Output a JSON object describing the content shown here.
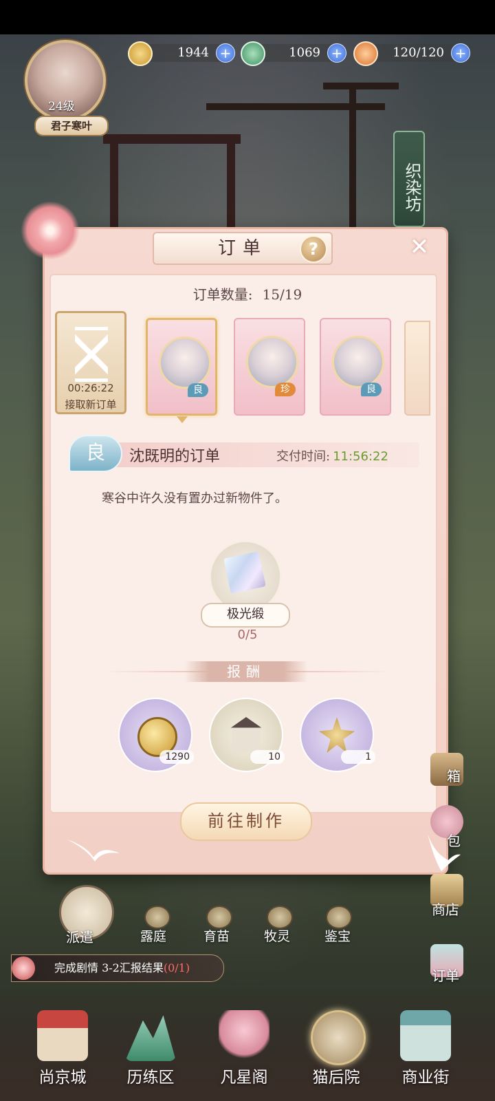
{
  "player": {
    "level": "24级",
    "name": "君子寒叶"
  },
  "resources": [
    {
      "icon": "paw-coin-icon",
      "value": "1944"
    },
    {
      "icon": "jade-icon",
      "value": "1069"
    },
    {
      "icon": "stamina-food-icon",
      "value": "120/120"
    }
  ],
  "side_tab": "织染坊",
  "dialog": {
    "title": "订单",
    "help": "?",
    "close": "✕",
    "count_label": "订单数量:",
    "count_value": "15/19",
    "new_order": {
      "timer": "00:26:22",
      "label": "接取新订单"
    },
    "cards": [
      {
        "grade": "良",
        "color": "#5b9bb7"
      },
      {
        "grade": "珍",
        "color": "#e08a3a"
      },
      {
        "grade": "良",
        "color": "#5b9bb7"
      }
    ],
    "detail": {
      "grade": "良",
      "order_name": "沈既明的订单",
      "deliver_label": "交付时间:",
      "deliver_time": "11:56:22",
      "description": "寒谷中许久没有置办过新物件了。"
    },
    "required_item": {
      "name": "极光缎",
      "progress": "0/5"
    },
    "reward_title": "报酬",
    "rewards": [
      {
        "icon": "paw-coin-icon",
        "count": "1290"
      },
      {
        "icon": "pavilion-icon",
        "count": "10"
      },
      {
        "icon": "golden-lotus-icon",
        "count": "1"
      }
    ],
    "go_button": "前往制作"
  },
  "hud": {
    "dispatch": "派遣",
    "mini_buttons": [
      "露庭",
      "育苗",
      "牧灵",
      "鉴宝"
    ],
    "quest": {
      "text": "完成剧情 3-2汇报结果",
      "progress": "(0/1)"
    },
    "right_buttons": [
      "箱",
      "包",
      "商店",
      "订单"
    ]
  },
  "bottom_nav": [
    "尚京城",
    "历练区",
    "凡星阁",
    "猫后院",
    "商业街"
  ],
  "colors": {
    "accent": "#e8b7a6",
    "time_green": "#6a9b2e",
    "progress_red": "#a86767"
  }
}
